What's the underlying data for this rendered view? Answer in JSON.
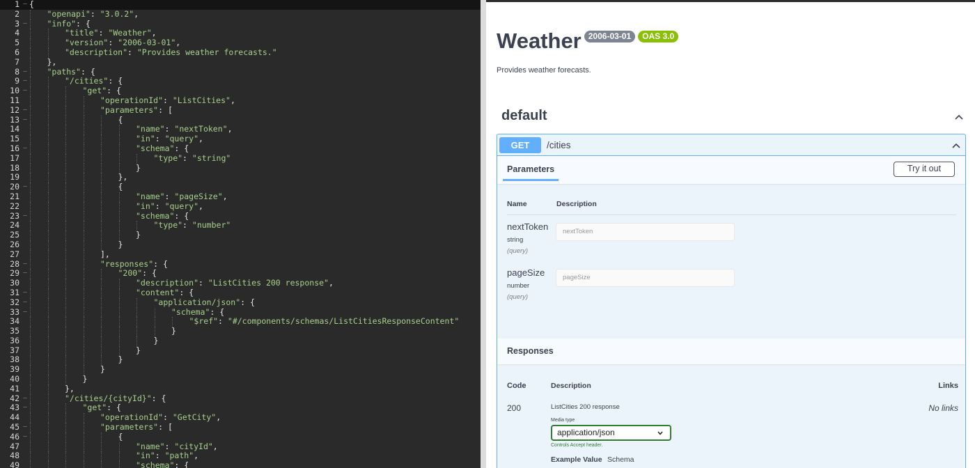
{
  "editor": {
    "lines": [
      [
        {
          "t": "{",
          "c": "pun"
        }
      ],
      [
        {
          "t": "\"openapi\"",
          "c": "str"
        },
        {
          "t": ": ",
          "c": "pun"
        },
        {
          "t": "\"3.0.2\"",
          "c": "str"
        },
        {
          "t": ",",
          "c": "pun"
        }
      ],
      [
        {
          "t": "\"info\"",
          "c": "str"
        },
        {
          "t": ": {",
          "c": "pun"
        }
      ],
      [
        {
          "t": "\"title\"",
          "c": "str"
        },
        {
          "t": ": ",
          "c": "pun"
        },
        {
          "t": "\"Weather\"",
          "c": "str"
        },
        {
          "t": ",",
          "c": "pun"
        }
      ],
      [
        {
          "t": "\"version\"",
          "c": "str"
        },
        {
          "t": ": ",
          "c": "pun"
        },
        {
          "t": "\"2006-03-01\"",
          "c": "str"
        },
        {
          "t": ",",
          "c": "pun"
        }
      ],
      [
        {
          "t": "\"description\"",
          "c": "str"
        },
        {
          "t": ": ",
          "c": "pun"
        },
        {
          "t": "\"Provides weather forecasts.\"",
          "c": "str"
        }
      ],
      [
        {
          "t": "},",
          "c": "pun"
        }
      ],
      [
        {
          "t": "\"paths\"",
          "c": "str"
        },
        {
          "t": ": {",
          "c": "pun"
        }
      ],
      [
        {
          "t": "\"/cities\"",
          "c": "str"
        },
        {
          "t": ": {",
          "c": "pun"
        }
      ],
      [
        {
          "t": "\"get\"",
          "c": "str"
        },
        {
          "t": ": {",
          "c": "pun"
        }
      ],
      [
        {
          "t": "\"operationId\"",
          "c": "str"
        },
        {
          "t": ": ",
          "c": "pun"
        },
        {
          "t": "\"ListCities\"",
          "c": "str"
        },
        {
          "t": ",",
          "c": "pun"
        }
      ],
      [
        {
          "t": "\"parameters\"",
          "c": "str"
        },
        {
          "t": ": [",
          "c": "pun"
        }
      ],
      [
        {
          "t": "{",
          "c": "pun"
        }
      ],
      [
        {
          "t": "\"name\"",
          "c": "str"
        },
        {
          "t": ": ",
          "c": "pun"
        },
        {
          "t": "\"nextToken\"",
          "c": "str"
        },
        {
          "t": ",",
          "c": "pun"
        }
      ],
      [
        {
          "t": "\"in\"",
          "c": "str"
        },
        {
          "t": ": ",
          "c": "pun"
        },
        {
          "t": "\"query\"",
          "c": "str"
        },
        {
          "t": ",",
          "c": "pun"
        }
      ],
      [
        {
          "t": "\"schema\"",
          "c": "str"
        },
        {
          "t": ": {",
          "c": "pun"
        }
      ],
      [
        {
          "t": "\"type\"",
          "c": "str"
        },
        {
          "t": ": ",
          "c": "pun"
        },
        {
          "t": "\"string\"",
          "c": "str"
        }
      ],
      [
        {
          "t": "}",
          "c": "pun"
        }
      ],
      [
        {
          "t": "},",
          "c": "pun"
        }
      ],
      [
        {
          "t": "{",
          "c": "pun"
        }
      ],
      [
        {
          "t": "\"name\"",
          "c": "str"
        },
        {
          "t": ": ",
          "c": "pun"
        },
        {
          "t": "\"pageSize\"",
          "c": "str"
        },
        {
          "t": ",",
          "c": "pun"
        }
      ],
      [
        {
          "t": "\"in\"",
          "c": "str"
        },
        {
          "t": ": ",
          "c": "pun"
        },
        {
          "t": "\"query\"",
          "c": "str"
        },
        {
          "t": ",",
          "c": "pun"
        }
      ],
      [
        {
          "t": "\"schema\"",
          "c": "str"
        },
        {
          "t": ": {",
          "c": "pun"
        }
      ],
      [
        {
          "t": "\"type\"",
          "c": "str"
        },
        {
          "t": ": ",
          "c": "pun"
        },
        {
          "t": "\"number\"",
          "c": "str"
        }
      ],
      [
        {
          "t": "}",
          "c": "pun"
        }
      ],
      [
        {
          "t": "}",
          "c": "pun"
        }
      ],
      [
        {
          "t": "],",
          "c": "pun"
        }
      ],
      [
        {
          "t": "\"responses\"",
          "c": "str"
        },
        {
          "t": ": {",
          "c": "pun"
        }
      ],
      [
        {
          "t": "\"200\"",
          "c": "str"
        },
        {
          "t": ": {",
          "c": "pun"
        }
      ],
      [
        {
          "t": "\"description\"",
          "c": "str"
        },
        {
          "t": ": ",
          "c": "pun"
        },
        {
          "t": "\"ListCities 200 response\"",
          "c": "str"
        },
        {
          "t": ",",
          "c": "pun"
        }
      ],
      [
        {
          "t": "\"content\"",
          "c": "str"
        },
        {
          "t": ": {",
          "c": "pun"
        }
      ],
      [
        {
          "t": "\"application/json\"",
          "c": "str"
        },
        {
          "t": ": {",
          "c": "pun"
        }
      ],
      [
        {
          "t": "\"schema\"",
          "c": "str"
        },
        {
          "t": ": {",
          "c": "pun"
        }
      ],
      [
        {
          "t": "\"$ref\"",
          "c": "str"
        },
        {
          "t": ": ",
          "c": "pun"
        },
        {
          "t": "\"#/components/schemas/ListCitiesResponseContent\"",
          "c": "str"
        }
      ],
      [
        {
          "t": "}",
          "c": "pun"
        }
      ],
      [
        {
          "t": "}",
          "c": "pun"
        }
      ],
      [
        {
          "t": "}",
          "c": "pun"
        }
      ],
      [
        {
          "t": "}",
          "c": "pun"
        }
      ],
      [
        {
          "t": "}",
          "c": "pun"
        }
      ],
      [
        {
          "t": "}",
          "c": "pun"
        }
      ],
      [
        {
          "t": "},",
          "c": "pun"
        }
      ],
      [
        {
          "t": "\"/cities/{cityId}\"",
          "c": "str"
        },
        {
          "t": ": {",
          "c": "pun"
        }
      ],
      [
        {
          "t": "\"get\"",
          "c": "str"
        },
        {
          "t": ": {",
          "c": "pun"
        }
      ],
      [
        {
          "t": "\"operationId\"",
          "c": "str"
        },
        {
          "t": ": ",
          "c": "pun"
        },
        {
          "t": "\"GetCity\"",
          "c": "str"
        },
        {
          "t": ",",
          "c": "pun"
        }
      ],
      [
        {
          "t": "\"parameters\"",
          "c": "str"
        },
        {
          "t": ": [",
          "c": "pun"
        }
      ],
      [
        {
          "t": "{",
          "c": "pun"
        }
      ],
      [
        {
          "t": "\"name\"",
          "c": "str"
        },
        {
          "t": ": ",
          "c": "pun"
        },
        {
          "t": "\"cityId\"",
          "c": "str"
        },
        {
          "t": ",",
          "c": "pun"
        }
      ],
      [
        {
          "t": "\"in\"",
          "c": "str"
        },
        {
          "t": ": ",
          "c": "pun"
        },
        {
          "t": "\"path\"",
          "c": "str"
        },
        {
          "t": ",",
          "c": "pun"
        }
      ],
      [
        {
          "t": "\"schema\"",
          "c": "str"
        },
        {
          "t": ": {",
          "c": "pun"
        }
      ]
    ],
    "indents": [
      0,
      1,
      1,
      2,
      2,
      2,
      1,
      1,
      2,
      3,
      4,
      4,
      5,
      6,
      6,
      6,
      7,
      6,
      5,
      5,
      6,
      6,
      6,
      7,
      6,
      5,
      4,
      4,
      5,
      6,
      6,
      7,
      8,
      9,
      8,
      7,
      6,
      5,
      4,
      3,
      2,
      2,
      3,
      4,
      4,
      5,
      6,
      6,
      6
    ],
    "foldable": [
      1,
      3,
      8,
      9,
      10,
      12,
      13,
      16,
      20,
      23,
      28,
      29,
      31,
      32,
      33,
      42,
      43,
      45,
      46
    ]
  },
  "swagger": {
    "title": "Weather",
    "version_badge": "2006-03-01",
    "oas_badge": "OAS 3.0",
    "description": "Provides weather forecasts.",
    "tag": "default",
    "operation": {
      "method": "GET",
      "path": "/cities",
      "parameters_tab": "Parameters",
      "try_button": "Try it out",
      "col_name": "Name",
      "col_description": "Description",
      "params": [
        {
          "name": "nextToken",
          "type": "string",
          "in": "(query)",
          "placeholder": "nextToken"
        },
        {
          "name": "pageSize",
          "type": "number",
          "in": "(query)",
          "placeholder": "pageSize"
        }
      ],
      "responses_title": "Responses",
      "resp_col_code": "Code",
      "resp_col_description": "Description",
      "resp_col_links": "Links",
      "response": {
        "code": "200",
        "description": "ListCities 200 response",
        "links": "No links",
        "media_type_label": "Media type",
        "media_type": "application/json",
        "controls_note": "Controls Accept header.",
        "example_value": "Example Value",
        "schema_tab": "Schema"
      }
    }
  }
}
